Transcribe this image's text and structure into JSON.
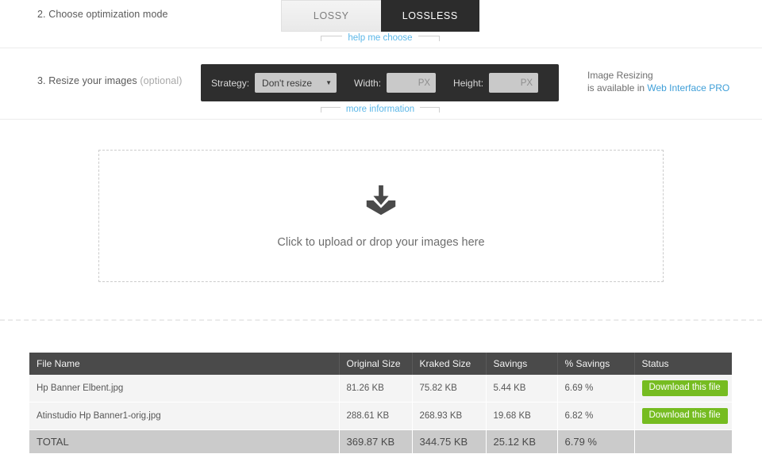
{
  "steps": {
    "mode": {
      "label": "2. Choose optimization mode",
      "options": [
        {
          "label": "LOSSY",
          "active": false
        },
        {
          "label": "LOSSLESS",
          "active": true
        }
      ],
      "help_link": "help me choose"
    },
    "resize": {
      "label_number": "3. Resize your images ",
      "label_optional": "(optional)",
      "strategy_label": "Strategy:",
      "strategy_value": "Don't resize",
      "width_label": "Width:",
      "width_placeholder": "PX",
      "width_value": "",
      "height_label": "Height:",
      "height_placeholder": "PX",
      "height_value": "",
      "more_info_link": "more information",
      "pro_note_line1": "Image Resizing",
      "pro_note_line2_prefix": "is available in ",
      "pro_note_link": "Web Interface PRO"
    }
  },
  "dropzone": {
    "text": "Click to upload or drop your images here",
    "icon": "upload-tray-icon"
  },
  "results": {
    "columns": [
      "File Name",
      "Original Size",
      "Kraked Size",
      "Savings",
      "% Savings",
      "Status"
    ],
    "rows": [
      {
        "file_name": "Hp Banner Elbent.jpg",
        "original_size": "81.26 KB",
        "kraked_size": "75.82 KB",
        "savings": "5.44 KB",
        "percent_savings": "6.69 %",
        "status": "Download this file"
      },
      {
        "file_name": "Atinstudio Hp Banner1-orig.jpg",
        "original_size": "288.61 KB",
        "kraked_size": "268.93 KB",
        "savings": "19.68 KB",
        "percent_savings": "6.82 %",
        "status": "Download this file"
      }
    ],
    "total": {
      "file_name": "TOTAL",
      "original_size": "369.87 KB",
      "kraked_size": "344.75 KB",
      "savings": "25.12 KB",
      "percent_savings": "6.79 %",
      "status": ""
    }
  },
  "colors": {
    "accent_green": "#76bc21",
    "link_blue": "#3f9fd8",
    "dark_panel": "#2e2e2e",
    "table_header": "#4a4a4a",
    "total_row": "#cbcbcb"
  }
}
